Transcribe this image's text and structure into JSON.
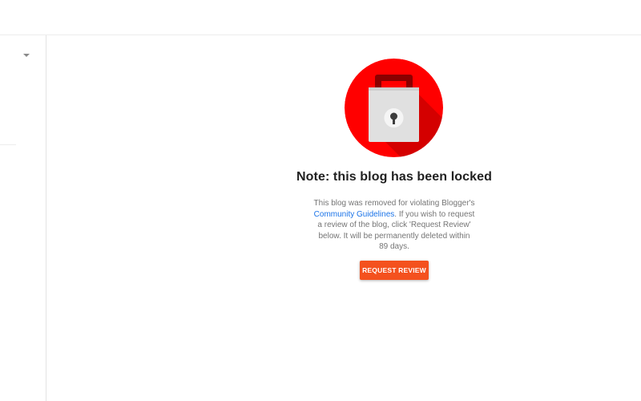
{
  "sidebar": {
    "dropdown_icon": "triangle-down-icon"
  },
  "main": {
    "lock_icon": "padlock-icon",
    "lock_colors": {
      "circle": "#ff0000",
      "shadow": "#cc0000",
      "shackle": "#8b0000",
      "body": "#e0e0e0",
      "keyhole": "#3d3d3d"
    },
    "title": "Note: this blog has been locked",
    "message": {
      "before_link": "This blog was removed for violating Blogger's ",
      "link_text": "Community Guidelines",
      "after_link": ". If you wish to request a review of the blog, click 'Request Review' below. It will be permanently deleted within 89 days."
    },
    "request_review_label": "REQUEST REVIEW",
    "button_color": "#f4511e"
  }
}
